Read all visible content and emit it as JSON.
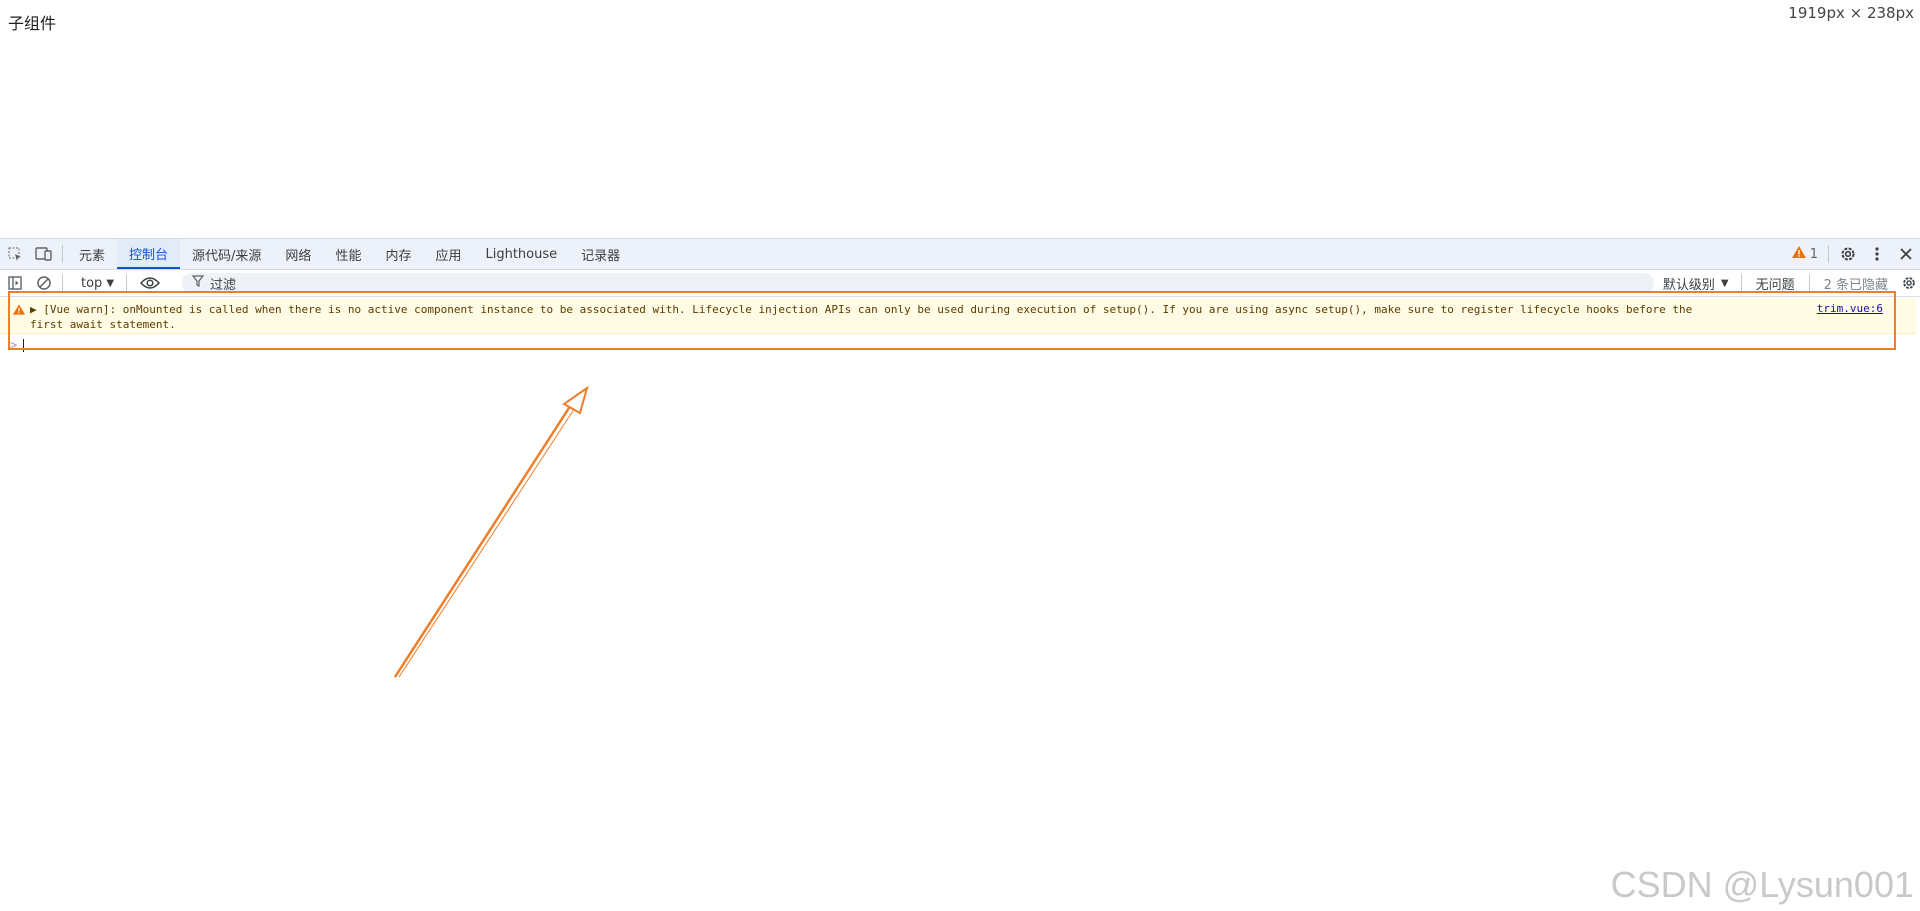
{
  "page": {
    "text": "子组件",
    "dimensions": "1919px × 238px"
  },
  "devtools": {
    "tabs": [
      {
        "label": "元素"
      },
      {
        "label": "控制台",
        "active": true
      },
      {
        "label": "源代码/来源"
      },
      {
        "label": "网络"
      },
      {
        "label": "性能"
      },
      {
        "label": "内存"
      },
      {
        "label": "应用"
      },
      {
        "label": "Lighthouse"
      },
      {
        "label": "记录器"
      }
    ],
    "warning_count": "1",
    "icons": [
      "inspect-element-icon",
      "device-toolbar-icon",
      "warning-icon",
      "settings-icon",
      "more-vert-icon",
      "close-icon"
    ]
  },
  "toolbar": {
    "context": "top",
    "filter_placeholder": "过滤",
    "level": "默认级别",
    "issues": "无问题",
    "hidden": "2 条已隐藏"
  },
  "console": {
    "message": "▶ [Vue warn]: onMounted is called when there is no active component instance to be associated with. Lifecycle injection APIs can only be used during execution of setup(). If you are using async setup(), make sure to register lifecycle hooks before the\nfirst await statement.",
    "source": "trim.vue:6",
    "prompt": ">"
  },
  "colors": {
    "warning_bg": "#fffbe5",
    "accent": "#0b57d0",
    "annotation": "#f07d2a"
  },
  "watermark": "CSDN @Lysun001"
}
